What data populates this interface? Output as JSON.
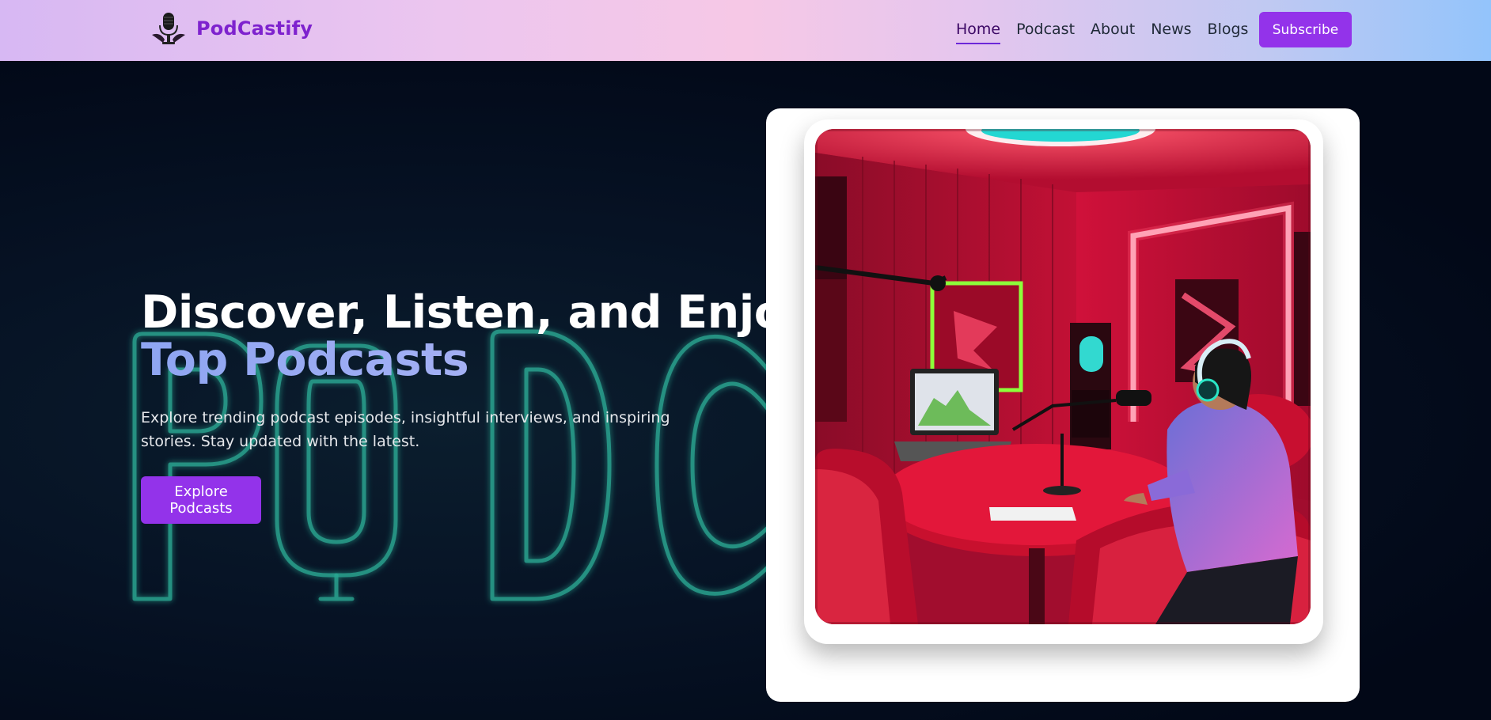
{
  "navbar": {
    "brand_name": "PodCastify",
    "logo_icon": "microphone-logo-icon",
    "links": [
      {
        "label": "Home",
        "active": true
      },
      {
        "label": "Podcast",
        "active": false
      },
      {
        "label": "About",
        "active": false
      },
      {
        "label": "News",
        "active": false
      },
      {
        "label": "Blogs",
        "active": false
      }
    ],
    "subscribe_label": "Subscribe"
  },
  "hero": {
    "title_line1": "Discover, Listen, and Enjoy",
    "title_line2": "Top Podcasts",
    "description": "Explore trending podcast episodes, insightful interviews, and inspiring stories. Stay updated with the latest.",
    "cta_label": "Explore Podcasts",
    "background_art": "neon-podcast-lettering",
    "image": "podcast-studio-illustration"
  },
  "colors": {
    "accent": "#9333ea",
    "brand": "#7e22ce",
    "hero_background": "#020817",
    "neon": "#2dd4bf"
  }
}
